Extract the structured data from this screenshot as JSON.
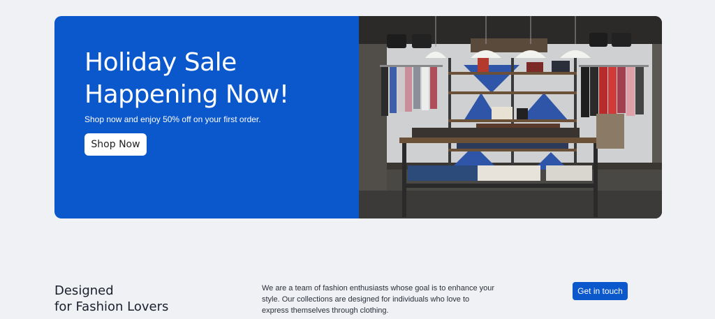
{
  "hero": {
    "title_line1": "Holiday Sale",
    "title_line2": "Happening Now!",
    "subtitle": "Shop now and enjoy 50% off on your first order.",
    "button_label": "Shop Now",
    "accent_color": "#0b57cc",
    "image_icon": "store-interior-photo"
  },
  "about": {
    "title_line1": "Designed",
    "title_line2": "for Fashion Lovers",
    "text_line1": "We are a team of fashion enthusiasts whose goal is to enhance your",
    "text_line2": "style. Our collections are designed for individuals who love to",
    "text_line3": "express themselves through clothing.",
    "button_label": "Get in touch"
  }
}
